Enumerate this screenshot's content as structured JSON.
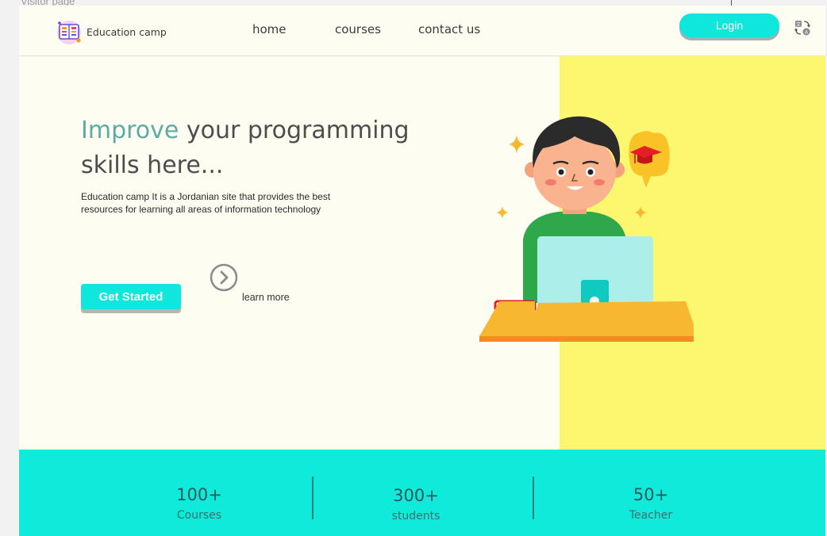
{
  "frame": {
    "label": "Visitor page"
  },
  "brand": {
    "name": "Education camp"
  },
  "nav": {
    "items": [
      "home",
      "courses",
      "contact us"
    ]
  },
  "header": {
    "login_label": "Login"
  },
  "hero": {
    "headline_accent": "Improve",
    "headline_rest": " your programming skills here...",
    "description": "Education camp It is a Jordanian site that provides the best resources for learning all areas of information technology",
    "cta_label": "Get Started",
    "learn_more_label": "learn more"
  },
  "stats": [
    {
      "value": "100+",
      "label": "Courses"
    },
    {
      "value": "300+",
      "label": "students"
    },
    {
      "value": "50+",
      "label": "Teacher"
    }
  ],
  "colors": {
    "accent": "#0fe6dc",
    "stats_bg": "#10eada",
    "hero_right": "#fdf66f",
    "page_bg": "#fdfdf1",
    "headline_accent": "#5fa9a6"
  },
  "icons": [
    "logo-book-icon",
    "translate-icon",
    "chevron-right-circle-icon"
  ]
}
